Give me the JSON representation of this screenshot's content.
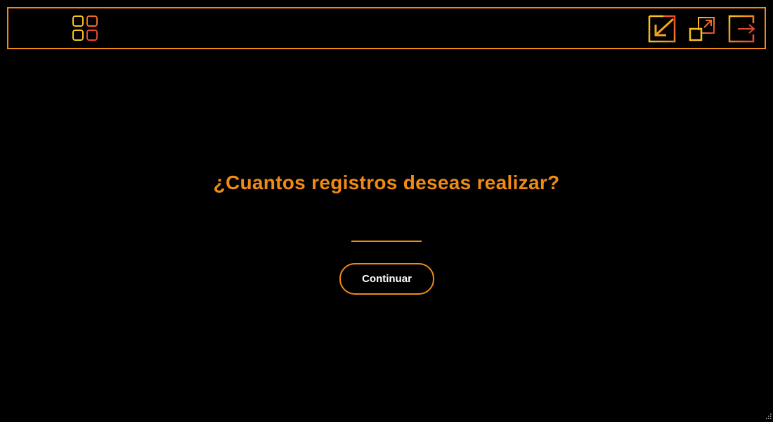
{
  "header": {
    "icons": {
      "menu": "apps-grid-icon",
      "minimize": "minimize-icon",
      "restore": "restore-window-icon",
      "exit": "exit-icon"
    }
  },
  "main": {
    "question": "¿Cuantos registros deseas realizar?",
    "count_input_value": "",
    "continue_label": "Continuar"
  },
  "colors": {
    "accent": "#f08a12",
    "gradient_start": "#f6c21c",
    "gradient_end": "#e8472f",
    "background": "#000000",
    "button_text": "#ffffff"
  }
}
